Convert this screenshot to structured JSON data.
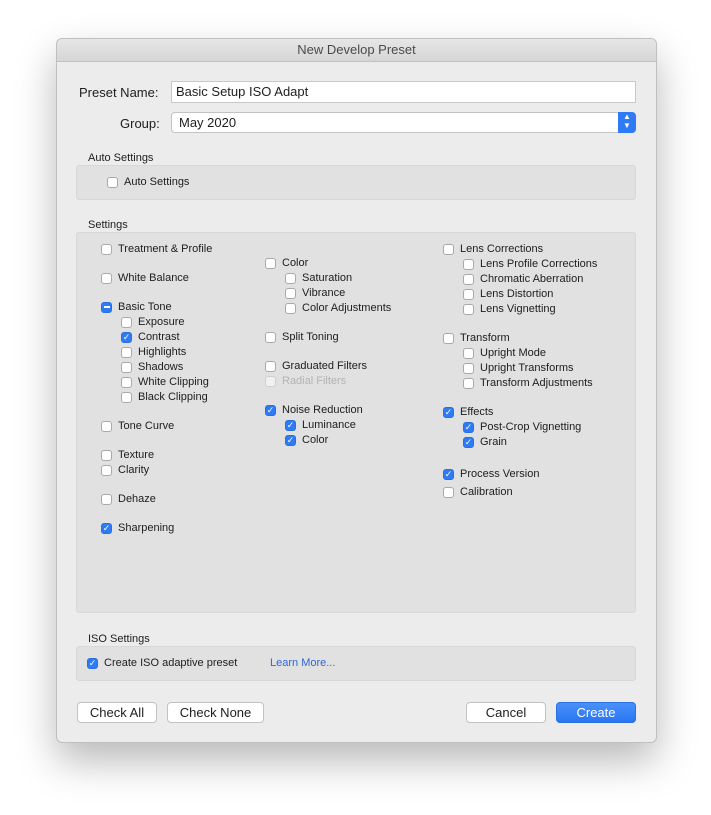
{
  "window": {
    "title": "New Develop Preset"
  },
  "preset": {
    "name_label": "Preset Name:",
    "name_value": "Basic Setup ISO Adapt",
    "group_label": "Group:",
    "group_value": "May 2020"
  },
  "auto_settings": {
    "title": "Auto Settings",
    "checkbox": {
      "label": "Auto Settings",
      "state": "off"
    }
  },
  "settings": {
    "title": "Settings",
    "col1": [
      {
        "label": "Treatment & Profile",
        "state": "off"
      },
      {
        "label": "White Balance",
        "state": "off"
      },
      {
        "label": "Basic Tone",
        "state": "mixed"
      },
      {
        "label": "Exposure",
        "state": "off"
      },
      {
        "label": "Contrast",
        "state": "on"
      },
      {
        "label": "Highlights",
        "state": "off"
      },
      {
        "label": "Shadows",
        "state": "off"
      },
      {
        "label": "White Clipping",
        "state": "off"
      },
      {
        "label": "Black Clipping",
        "state": "off"
      },
      {
        "label": "Tone Curve",
        "state": "off"
      },
      {
        "label": "Texture",
        "state": "off"
      },
      {
        "label": "Clarity",
        "state": "off"
      },
      {
        "label": "Dehaze",
        "state": "off"
      },
      {
        "label": "Sharpening",
        "state": "on"
      }
    ],
    "col2": [
      {
        "label": "Color",
        "state": "off"
      },
      {
        "label": "Saturation",
        "state": "off"
      },
      {
        "label": "Vibrance",
        "state": "off"
      },
      {
        "label": "Color Adjustments",
        "state": "off"
      },
      {
        "label": "Split Toning",
        "state": "off"
      },
      {
        "label": "Graduated Filters",
        "state": "off"
      },
      {
        "label": "Radial Filters",
        "state": "disabled"
      },
      {
        "label": "Noise Reduction",
        "state": "on"
      },
      {
        "label": "Luminance",
        "state": "on"
      },
      {
        "label": "Color",
        "state": "on"
      }
    ],
    "col3": [
      {
        "label": "Lens Corrections",
        "state": "off"
      },
      {
        "label": "Lens Profile Corrections",
        "state": "off"
      },
      {
        "label": "Chromatic Aberration",
        "state": "off"
      },
      {
        "label": "Lens Distortion",
        "state": "off"
      },
      {
        "label": "Lens Vignetting",
        "state": "off"
      },
      {
        "label": "Transform",
        "state": "off"
      },
      {
        "label": "Upright Mode",
        "state": "off"
      },
      {
        "label": "Upright Transforms",
        "state": "off"
      },
      {
        "label": "Transform Adjustments",
        "state": "off"
      },
      {
        "label": "Effects",
        "state": "on"
      },
      {
        "label": "Post-Crop Vignetting",
        "state": "on"
      },
      {
        "label": "Grain",
        "state": "on"
      },
      {
        "label": "Process Version",
        "state": "on"
      },
      {
        "label": "Calibration",
        "state": "off"
      }
    ]
  },
  "iso_settings": {
    "title": "ISO Settings",
    "checkbox": {
      "label": "Create ISO adaptive preset",
      "state": "on"
    },
    "link": "Learn More..."
  },
  "buttons": {
    "check_all": "Check All",
    "check_none": "Check None",
    "cancel": "Cancel",
    "create": "Create"
  },
  "colors": {
    "accent": "#2f7bf5",
    "window_bg": "#ececec",
    "panel_bg": "#e1e1e1",
    "link": "#2f66d9"
  }
}
